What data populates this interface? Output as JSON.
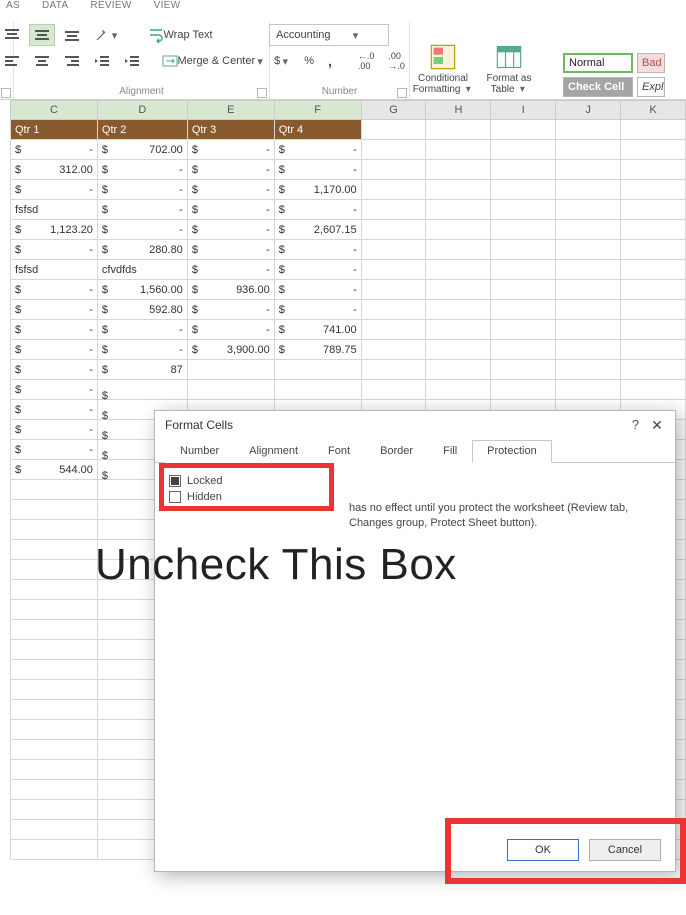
{
  "ribbon_tabs": {
    "t0": "AS",
    "t1": "DATA",
    "t2": "REVIEW",
    "t3": "VIEW"
  },
  "alignment": {
    "wrap": "Wrap Text",
    "merge": "Merge & Center",
    "label": "Alignment"
  },
  "number": {
    "style": "Accounting",
    "label": "Number",
    "cur": "$",
    "pct": "%",
    "comma": ",",
    "inc": ".0",
    "dec": ".00"
  },
  "cond": {
    "line1": "Conditional",
    "line2": "Formatting"
  },
  "fmt": {
    "line1": "Format as",
    "line2": "Table"
  },
  "styles": {
    "normal": "Normal",
    "bad": "Bad",
    "check": "Check Cell",
    "expl": "Expl"
  },
  "grid": {
    "cols": [
      "C",
      "D",
      "E",
      "F",
      "G",
      "H",
      "I",
      "J",
      "K"
    ],
    "headers": [
      "Qtr 1",
      "Qtr 2",
      "Qtr 3",
      "Qtr 4"
    ],
    "rows": [
      {
        "c": {
          "t": "cur",
          "v": "-"
        },
        "d": {
          "t": "cur",
          "v": "702.00"
        },
        "e": {
          "t": "cur",
          "v": "-"
        },
        "f": {
          "t": "cur",
          "v": "-"
        }
      },
      {
        "c": {
          "t": "cur",
          "v": "312.00"
        },
        "d": {
          "t": "cur",
          "v": "-"
        },
        "e": {
          "t": "cur",
          "v": "-"
        },
        "f": {
          "t": "cur",
          "v": "-"
        }
      },
      {
        "c": {
          "t": "cur",
          "v": "-"
        },
        "d": {
          "t": "cur",
          "v": "-"
        },
        "e": {
          "t": "cur",
          "v": "-"
        },
        "f": {
          "t": "cur",
          "v": "1,170.00"
        }
      },
      {
        "c": {
          "t": "txt",
          "v": "fsfsd"
        },
        "d": {
          "t": "cur",
          "v": "-"
        },
        "e": {
          "t": "cur",
          "v": "-"
        },
        "f": {
          "t": "cur",
          "v": "-"
        }
      },
      {
        "c": {
          "t": "cur",
          "v": "1,123.20"
        },
        "d": {
          "t": "cur",
          "v": "-"
        },
        "e": {
          "t": "cur",
          "v": "-"
        },
        "f": {
          "t": "cur",
          "v": "2,607.15"
        }
      },
      {
        "c": {
          "t": "cur",
          "v": "-"
        },
        "d": {
          "t": "cur",
          "v": "280.80"
        },
        "e": {
          "t": "cur",
          "v": "-"
        },
        "f": {
          "t": "cur",
          "v": "-"
        }
      },
      {
        "c": {
          "t": "txt",
          "v": "fsfsd"
        },
        "d": {
          "t": "txt",
          "v": "cfvdfds"
        },
        "e": {
          "t": "cur",
          "v": "-"
        },
        "f": {
          "t": "cur",
          "v": "-"
        }
      },
      {
        "c": {
          "t": "cur",
          "v": "-"
        },
        "d": {
          "t": "cur",
          "v": "1,560.00"
        },
        "e": {
          "t": "cur",
          "v": "936.00"
        },
        "f": {
          "t": "cur",
          "v": "-"
        }
      },
      {
        "c": {
          "t": "cur",
          "v": "-"
        },
        "d": {
          "t": "cur",
          "v": "592.80"
        },
        "e": {
          "t": "cur",
          "v": "-"
        },
        "f": {
          "t": "cur",
          "v": "-"
        }
      },
      {
        "c": {
          "t": "cur",
          "v": "-"
        },
        "d": {
          "t": "cur",
          "v": "-"
        },
        "e": {
          "t": "cur",
          "v": "-"
        },
        "f": {
          "t": "cur",
          "v": "741.00"
        }
      },
      {
        "c": {
          "t": "cur",
          "v": "-"
        },
        "d": {
          "t": "cur",
          "v": "-"
        },
        "e": {
          "t": "cur",
          "v": "3,900.00"
        },
        "f": {
          "t": "cur",
          "v": "789.75"
        }
      },
      {
        "c": {
          "t": "cur",
          "v": "-"
        },
        "d": {
          "t": "cur",
          "v": "87"
        },
        "e": null,
        "f": null
      },
      {
        "c": {
          "t": "cur",
          "v": "-"
        },
        "d": {
          "t": "cur",
          "v": ""
        },
        "e": null,
        "f": null
      },
      {
        "c": {
          "t": "cur",
          "v": "-"
        },
        "d": {
          "t": "cur",
          "v": ""
        },
        "e": null,
        "f": null
      },
      {
        "c": {
          "t": "cur",
          "v": "-"
        },
        "d": {
          "t": "cur",
          "v": ""
        },
        "e": null,
        "f": null
      },
      {
        "c": {
          "t": "cur",
          "v": "-"
        },
        "d": {
          "t": "cur",
          "v": ""
        },
        "e": null,
        "f": null
      },
      {
        "c": {
          "t": "cur",
          "v": "544.00"
        },
        "d": {
          "t": "cur",
          "v": ""
        },
        "e": null,
        "f": null
      }
    ],
    "blank_rows": 19
  },
  "dialog": {
    "title": "Format Cells",
    "tabs": {
      "number": "Number",
      "alignment": "Alignment",
      "font": "Font",
      "border": "Border",
      "fill": "Fill",
      "protection": "Protection"
    },
    "locked": "Locked",
    "hidden": "Hidden",
    "note_pre": "has no effect until you protect the worksheet (Review tab, Changes group, Protect Sheet button).",
    "ok": "OK",
    "cancel": "Cancel"
  },
  "annot": {
    "text": "Uncheck This Box"
  }
}
